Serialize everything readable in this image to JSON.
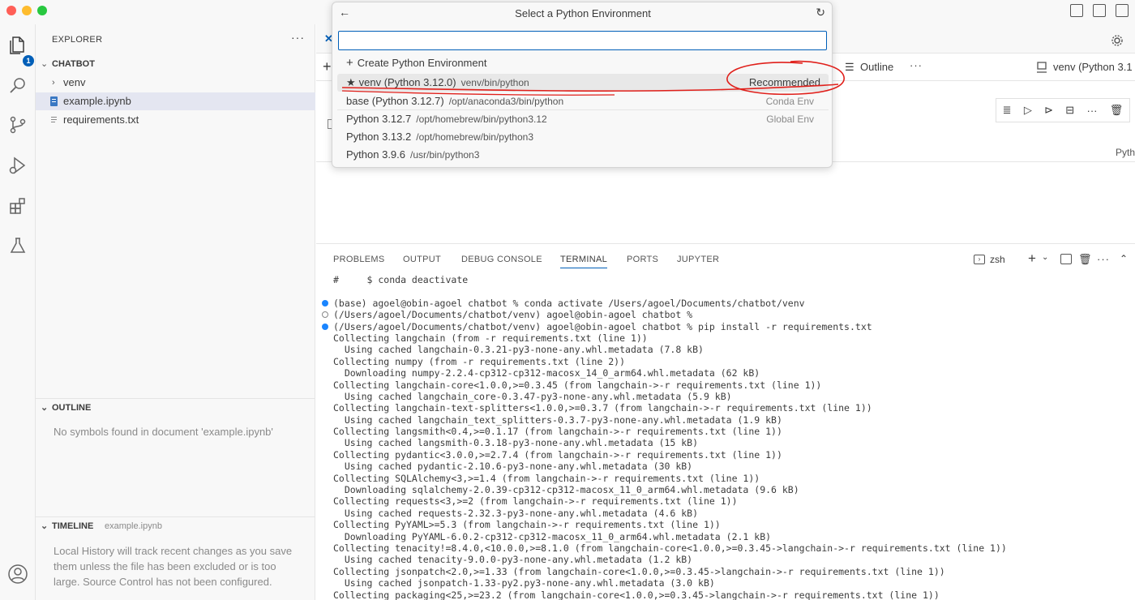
{
  "quickpick": {
    "title": "Select a Python Environment",
    "input_value": "",
    "create_label": "Create Python Environment",
    "items": [
      {
        "name": "venv (Python 3.12.0)",
        "path": "venv/bin/python",
        "detail": "Recommended"
      },
      {
        "name": "base (Python 3.12.7)",
        "path": "/opt/anaconda3/bin/python",
        "detail": "Conda Env"
      },
      {
        "name": "Python 3.12.7",
        "path": "/opt/homebrew/bin/python3.12",
        "detail": "Global Env"
      },
      {
        "name": "Python 3.13.2",
        "path": "/opt/homebrew/bin/python3",
        "detail": ""
      },
      {
        "name": "Python 3.9.6",
        "path": "/usr/bin/python3",
        "detail": ""
      }
    ]
  },
  "activity": {
    "badge_count": "1"
  },
  "sidebar": {
    "title": "EXPLORER",
    "more": "···",
    "folder": "CHATBOT",
    "tree": [
      {
        "label": "venv"
      },
      {
        "label": "example.ipynb"
      },
      {
        "label": "requirements.txt"
      }
    ],
    "outline_title": "OUTLINE",
    "outline_empty": "No symbols found in document 'example.ipynb'",
    "timeline_title": "TIMELINE",
    "timeline_file": "example.ipynb",
    "timeline_text": "Local History will track recent changes as you save them unless the file has been excluded or is too large. Source Control has not been configured."
  },
  "editor": {
    "outline_label": "Outline",
    "more": "···",
    "kernel_label": "venv (Python 3.1",
    "kernel_row_partial": "Pyth"
  },
  "panel": {
    "tabs": [
      "PROBLEMS",
      "OUTPUT",
      "DEBUG CONSOLE",
      "TERMINAL",
      "PORTS",
      "JUPYTER"
    ],
    "shell": "zsh",
    "lines": [
      {
        "dot": "",
        "text": "#     $ conda deactivate"
      },
      {
        "dot": "",
        "text": ""
      },
      {
        "dot": "filled",
        "text": "(base) agoel@obin-agoel chatbot % conda activate /Users/agoel/Documents/chatbot/venv"
      },
      {
        "dot": "hollow",
        "text": "(/Users/agoel/Documents/chatbot/venv) agoel@obin-agoel chatbot %"
      },
      {
        "dot": "filled",
        "text": "(/Users/agoel/Documents/chatbot/venv) agoel@obin-agoel chatbot % pip install -r requirements.txt"
      },
      {
        "dot": "",
        "text": "Collecting langchain (from -r requirements.txt (line 1))"
      },
      {
        "dot": "",
        "text": "  Using cached langchain-0.3.21-py3-none-any.whl.metadata (7.8 kB)"
      },
      {
        "dot": "",
        "text": "Collecting numpy (from -r requirements.txt (line 2))"
      },
      {
        "dot": "",
        "text": "  Downloading numpy-2.2.4-cp312-cp312-macosx_14_0_arm64.whl.metadata (62 kB)"
      },
      {
        "dot": "",
        "text": "Collecting langchain-core<1.0.0,>=0.3.45 (from langchain->-r requirements.txt (line 1))"
      },
      {
        "dot": "",
        "text": "  Using cached langchain_core-0.3.47-py3-none-any.whl.metadata (5.9 kB)"
      },
      {
        "dot": "",
        "text": "Collecting langchain-text-splitters<1.0.0,>=0.3.7 (from langchain->-r requirements.txt (line 1))"
      },
      {
        "dot": "",
        "text": "  Using cached langchain_text_splitters-0.3.7-py3-none-any.whl.metadata (1.9 kB)"
      },
      {
        "dot": "",
        "text": "Collecting langsmith<0.4,>=0.1.17 (from langchain->-r requirements.txt (line 1))"
      },
      {
        "dot": "",
        "text": "  Using cached langsmith-0.3.18-py3-none-any.whl.metadata (15 kB)"
      },
      {
        "dot": "",
        "text": "Collecting pydantic<3.0.0,>=2.7.4 (from langchain->-r requirements.txt (line 1))"
      },
      {
        "dot": "",
        "text": "  Using cached pydantic-2.10.6-py3-none-any.whl.metadata (30 kB)"
      },
      {
        "dot": "",
        "text": "Collecting SQLAlchemy<3,>=1.4 (from langchain->-r requirements.txt (line 1))"
      },
      {
        "dot": "",
        "text": "  Downloading sqlalchemy-2.0.39-cp312-cp312-macosx_11_0_arm64.whl.metadata (9.6 kB)"
      },
      {
        "dot": "",
        "text": "Collecting requests<3,>=2 (from langchain->-r requirements.txt (line 1))"
      },
      {
        "dot": "",
        "text": "  Using cached requests-2.32.3-py3-none-any.whl.metadata (4.6 kB)"
      },
      {
        "dot": "",
        "text": "Collecting PyYAML>=5.3 (from langchain->-r requirements.txt (line 1))"
      },
      {
        "dot": "",
        "text": "  Downloading PyYAML-6.0.2-cp312-cp312-macosx_11_0_arm64.whl.metadata (2.1 kB)"
      },
      {
        "dot": "",
        "text": "Collecting tenacity!=8.4.0,<10.0.0,>=8.1.0 (from langchain-core<1.0.0,>=0.3.45->langchain->-r requirements.txt (line 1))"
      },
      {
        "dot": "",
        "text": "  Using cached tenacity-9.0.0-py3-none-any.whl.metadata (1.2 kB)"
      },
      {
        "dot": "",
        "text": "Collecting jsonpatch<2.0,>=1.33 (from langchain-core<1.0.0,>=0.3.45->langchain->-r requirements.txt (line 1))"
      },
      {
        "dot": "",
        "text": "  Using cached jsonpatch-1.33-py2.py3-none-any.whl.metadata (3.0 kB)"
      },
      {
        "dot": "",
        "text": "Collecting packaging<25,>=23.2 (from langchain-core<1.0.0,>=0.3.45->langchain->-r requirements.txt (line 1))"
      }
    ]
  },
  "colors": {
    "accent": "#005fb8",
    "annotation": "#e0201b",
    "dot_active": "#1a85ff"
  }
}
